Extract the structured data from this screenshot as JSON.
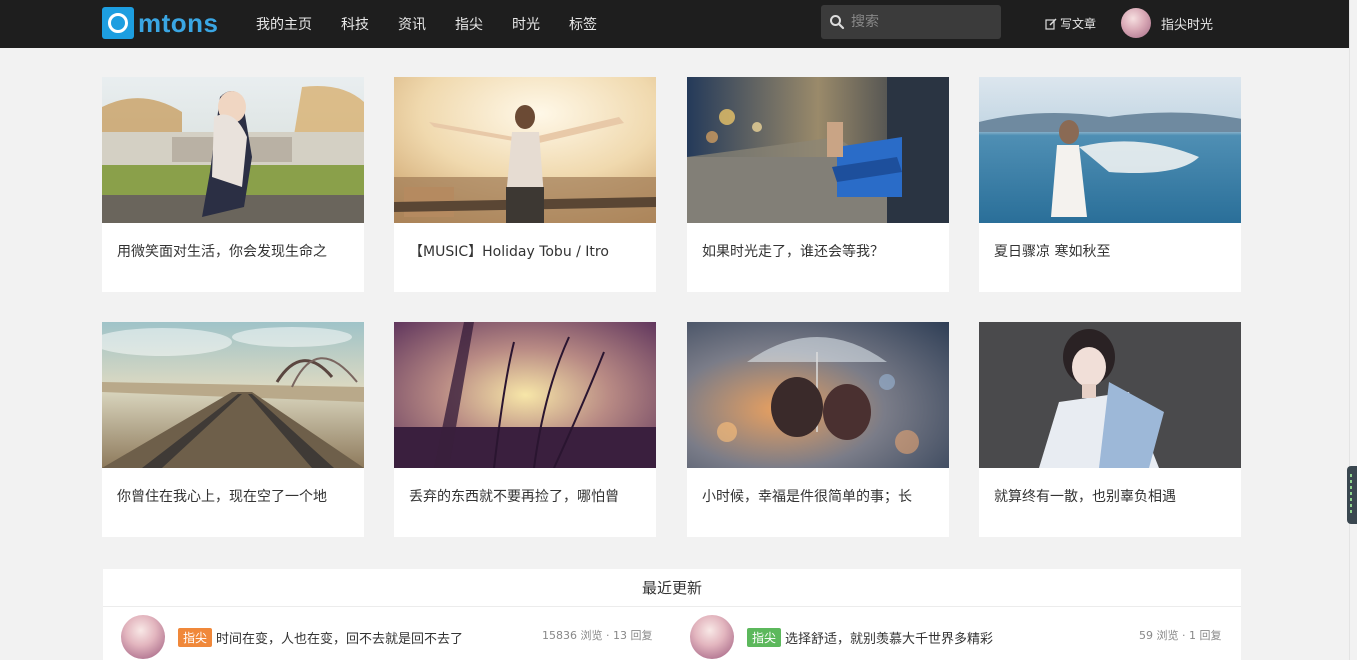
{
  "brand": {
    "name": "mtons",
    "color": "#3aa6e3"
  },
  "nav": {
    "items": [
      "我的主页",
      "科技",
      "资讯",
      "指尖",
      "时光",
      "标签"
    ]
  },
  "search": {
    "placeholder": "搜索"
  },
  "header_actions": {
    "write_label": "写文章",
    "username": "指尖时光"
  },
  "cards": [
    {
      "title": "用微笑面对生活，你会发现生命之"
    },
    {
      "title": "【MUSIC】Holiday Tobu / Itro"
    },
    {
      "title": "如果时光走了，谁还会等我？"
    },
    {
      "title": "夏日骤凉 寒如秋至"
    },
    {
      "title": "你曾住在我心上，现在空了一个地"
    },
    {
      "title": "丢弃的东西就不要再捡了，哪怕曾"
    },
    {
      "title": "小时候，幸福是件很简单的事；长"
    },
    {
      "title": "就算终有一散，也别辜负相遇"
    }
  ],
  "recent": {
    "header": "最近更新",
    "items": [
      {
        "tag": "指尖",
        "tag_color": "#f0883a",
        "title": "时间在变，人也在变，回不去就是回不去了",
        "meta": "15836 浏览 · 13 回复"
      },
      {
        "tag": "指尖",
        "tag_color": "#5cb85c",
        "title": "选择舒适，就别羡慕大千世界多精彩",
        "meta": "59 浏览 · 1 回复"
      }
    ]
  }
}
